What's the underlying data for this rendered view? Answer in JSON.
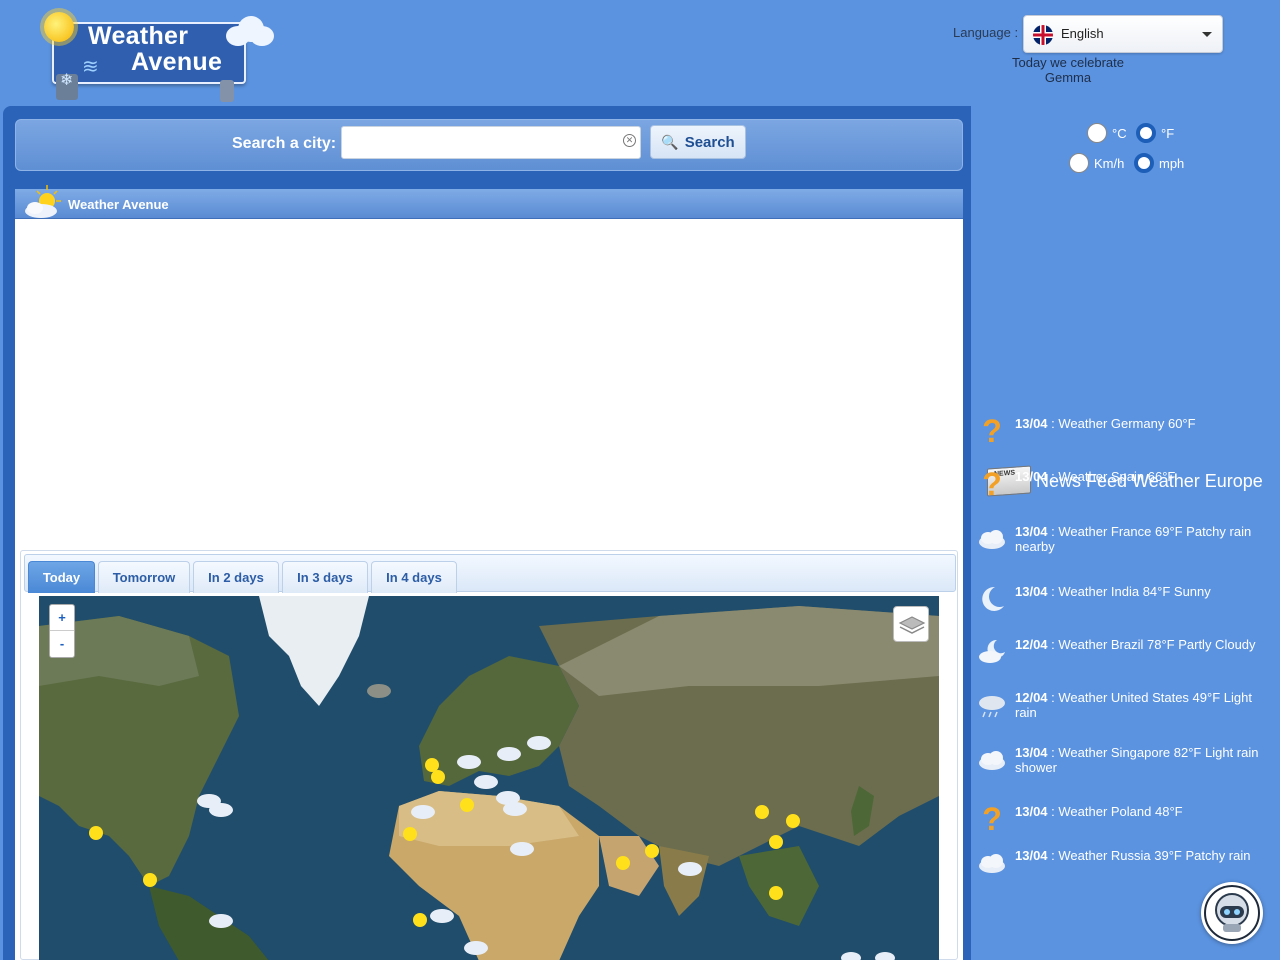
{
  "header": {
    "logo_line1": "Weather",
    "logo_line2": "Avenue",
    "language_label": "Language :",
    "language_value": "English",
    "celebrate_text": "Today we celebrate Gemma"
  },
  "search": {
    "label": "Search a city:",
    "input_value": "",
    "placeholder": "",
    "button_label": "Search"
  },
  "card": {
    "title": "Weather Avenue"
  },
  "forecast": {
    "tabs": [
      "Today",
      "Tomorrow",
      "In 2 days",
      "In 3 days",
      "In 4 days"
    ],
    "active_tab": "Today",
    "zoom_in": "+",
    "zoom_out": "-"
  },
  "units": {
    "temp_c": "°C",
    "temp_f": "°F",
    "speed_kmh": "Km/h",
    "speed_mph": "mph",
    "selected_temp": "°F",
    "selected_speed": "mph"
  },
  "news": {
    "title": "News Feed Weather Europe",
    "items": [
      {
        "date": "13/04",
        "text": " : Weather Germany 60°F",
        "icon": "question-icon"
      },
      {
        "date": "13/04",
        "text": " : Weather Spain 66°F",
        "icon": "question-icon"
      },
      {
        "date": "13/04",
        "text": " : Weather France 69°F Patchy rain nearby",
        "icon": "cloud-icon"
      },
      {
        "date": "13/04",
        "text": " : Weather India 84°F Sunny",
        "icon": "moon-icon"
      },
      {
        "date": "12/04",
        "text": " : Weather Brazil 78°F Partly Cloudy",
        "icon": "moon-cloud-icon"
      },
      {
        "date": "12/04",
        "text": " : Weather United States 49°F Light rain",
        "icon": "rain-cloud-icon"
      },
      {
        "date": "13/04",
        "text": " : Weather Singapore 82°F Light rain shower",
        "icon": "cloud-icon"
      },
      {
        "date": "13/04",
        "text": " : Weather Poland 48°F",
        "icon": "question-icon"
      },
      {
        "date": "13/04",
        "text": " : Weather Russia 39°F Patchy rain",
        "icon": "cloud-icon"
      }
    ]
  },
  "colors": {
    "page_bg": "#5b93e0",
    "panel_bg": "#2b63b8",
    "accent": "#4a88d6",
    "question_orange": "#f2a126"
  }
}
